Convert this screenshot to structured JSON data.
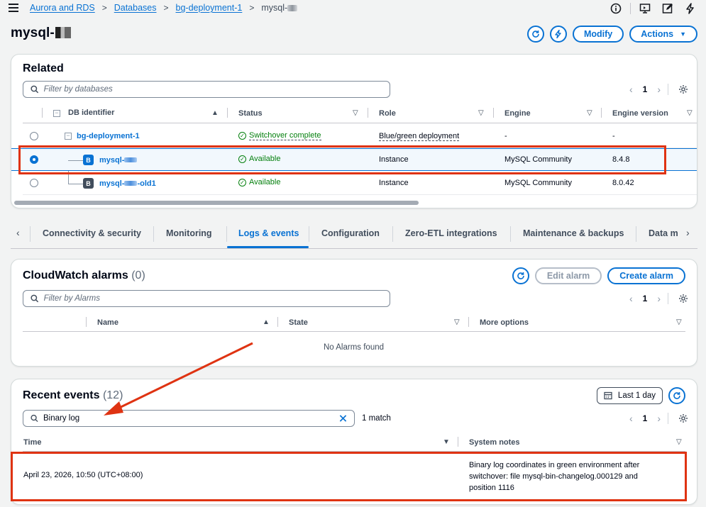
{
  "breadcrumbs": [
    "Aurora and RDS",
    "Databases",
    "bg-deployment-1",
    "mysql-"
  ],
  "page_title": "mysql-",
  "header_buttons": {
    "modify": "Modify",
    "actions": "Actions"
  },
  "related": {
    "title": "Related",
    "filter_placeholder": "Filter by databases",
    "page": "1",
    "columns": [
      "DB identifier",
      "Status",
      "Role",
      "Engine",
      "Engine version"
    ],
    "rows": [
      {
        "id": "bg-deployment-1",
        "status": "Switchover complete",
        "role": "Blue/green deployment",
        "engine": "-",
        "version": "-",
        "badge": ""
      },
      {
        "id": "mysql-",
        "status": "Available",
        "role": "Instance",
        "engine": "MySQL Community",
        "version": "8.4.8",
        "badge": "B"
      },
      {
        "id_prefix": "mysql-",
        "id_suffix": "-old1",
        "status": "Available",
        "role": "Instance",
        "engine": "MySQL Community",
        "version": "8.0.42",
        "badge": "B"
      }
    ]
  },
  "tabs": [
    "Connectivity & security",
    "Monitoring",
    "Logs & events",
    "Configuration",
    "Zero-ETL integrations",
    "Maintenance & backups",
    "Data m"
  ],
  "alarms": {
    "title": "CloudWatch alarms",
    "count": "(0)",
    "edit_label": "Edit alarm",
    "create_label": "Create alarm",
    "filter_placeholder": "Filter by Alarms",
    "page": "1",
    "columns": [
      "Name",
      "State",
      "More options"
    ],
    "empty": "No Alarms found"
  },
  "events": {
    "title": "Recent events",
    "count": "(12)",
    "range_label": "Last 1 day",
    "search_value": "Binary log",
    "match_text": "1 match",
    "page": "1",
    "columns": [
      "Time",
      "System notes"
    ],
    "rows": [
      {
        "time": "April 23, 2026, 10:50 (UTC+08:00)",
        "notes": "Binary log coordinates in green environment after switchover: file mysql-bin-changelog.000129 and position 1116"
      }
    ]
  },
  "colors": {
    "accent": "#0972d3",
    "success": "#037f0c",
    "highlight": "#df3312"
  }
}
